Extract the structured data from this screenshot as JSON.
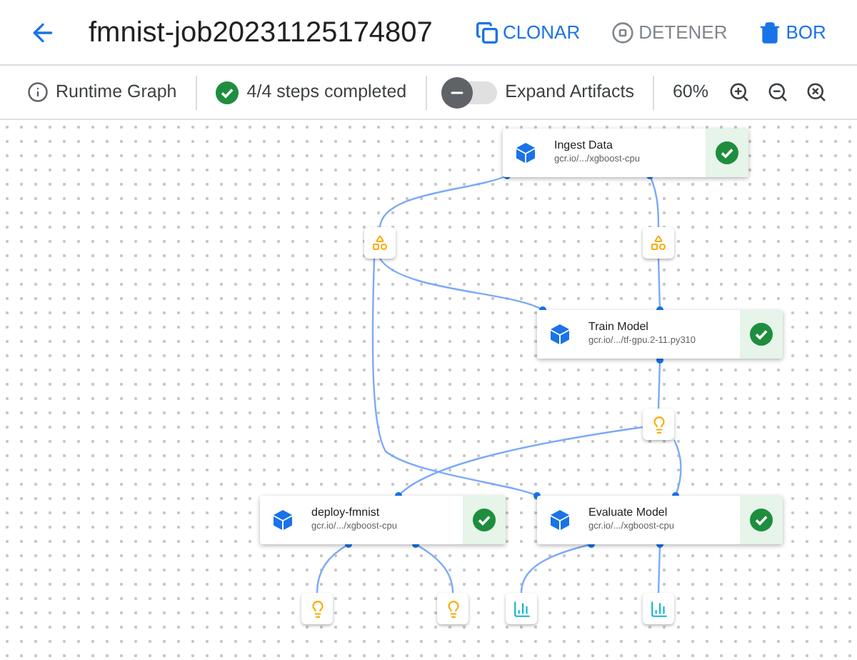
{
  "header": {
    "title": "fmnist-job20231125174807",
    "actions": [
      {
        "label": "CLONAR",
        "kind": "clone",
        "disabled": false
      },
      {
        "label": "DETENER",
        "kind": "stop",
        "disabled": true
      },
      {
        "label": "BOR",
        "kind": "delete",
        "disabled": false
      }
    ]
  },
  "toolbar": {
    "graph_label": "Runtime Graph",
    "steps": "4/4 steps completed",
    "expand_artifacts": {
      "label": "Expand Artifacts",
      "on": false
    },
    "zoom": "60%"
  },
  "nodes": [
    {
      "name": "Ingest Data",
      "image": "gcr.io/.../xgboost-cpu",
      "succeeded": true
    },
    {
      "name": "Train Model",
      "image": "gcr.io/.../tf-gpu.2-11.py310",
      "succeeded": true
    },
    {
      "name": "deploy-fmnist",
      "image": "gcr.io/.../xgboost-cpu",
      "succeeded": true
    },
    {
      "name": "Evaluate Model",
      "image": "gcr.io/.../xgboost-cpu",
      "succeeded": true
    }
  ],
  "artifacts": [
    {
      "kind": "dataset"
    },
    {
      "kind": "dataset"
    },
    {
      "kind": "model"
    },
    {
      "kind": "model"
    },
    {
      "kind": "model"
    },
    {
      "kind": "metrics"
    },
    {
      "kind": "metrics"
    }
  ]
}
